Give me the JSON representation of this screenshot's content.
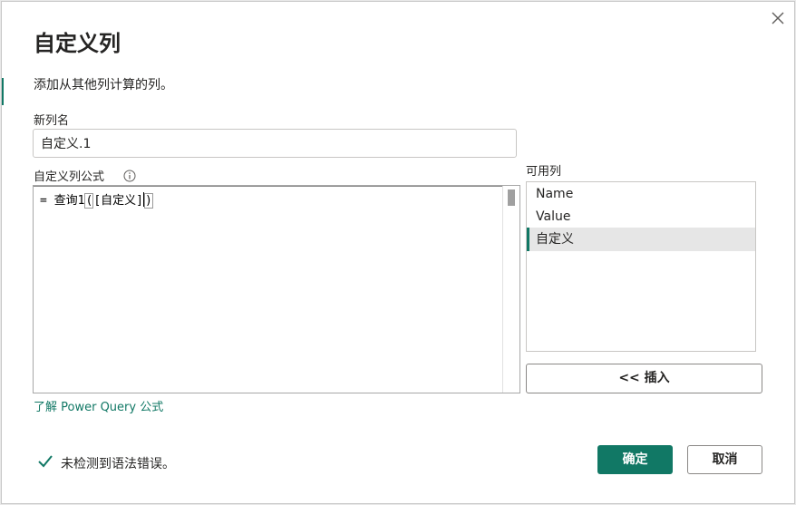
{
  "dialog": {
    "title": "自定义列",
    "subtitle": "添加从其他列计算的列。",
    "close_icon": "close-icon"
  },
  "new_column": {
    "label": "新列名",
    "value": "自定义.1"
  },
  "formula": {
    "label": "自定义列公式",
    "info_icon": "info-icon",
    "prefix": "= 查询1",
    "open_paren": "(",
    "body": "[自定义]",
    "close_paren": ")"
  },
  "available_columns": {
    "label": "可用列",
    "items": [
      {
        "label": "Name",
        "selected": false
      },
      {
        "label": "Value",
        "selected": false
      },
      {
        "label": "自定义",
        "selected": true
      }
    ],
    "insert_label": "<< 插入"
  },
  "learn_link": "了解 Power Query 公式",
  "status": {
    "icon": "check-icon",
    "text": "未检测到语法错误。"
  },
  "buttons": {
    "ok": "确定",
    "cancel": "取消"
  },
  "colors": {
    "accent": "#117865",
    "text": "#252423",
    "border": "#8a8886"
  }
}
